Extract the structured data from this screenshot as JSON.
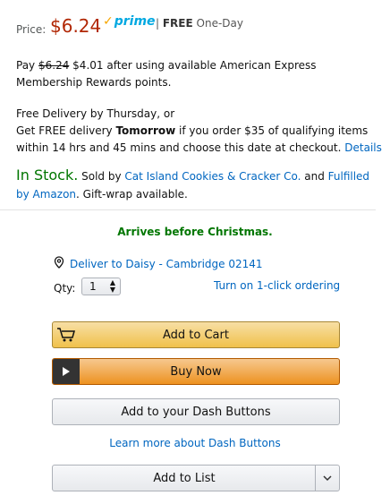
{
  "price": {
    "label": "Price:",
    "value": "$6.24",
    "prime": "prime",
    "shipping_free": "FREE",
    "shipping_speed": "One-Day"
  },
  "rewards": {
    "pay": "Pay",
    "old_price": "$6.24",
    "new_price_text": "$4.01 after using available American Express Membership Rewards points."
  },
  "delivery": {
    "line1": "Free Delivery by Thursday, or",
    "line2_a": "Get FREE delivery",
    "line2_b": "Tomorrow",
    "line2_c": "if you order $35 of qualifying items within 14 hrs and 45 mins and choose this date at checkout.",
    "details_link": "Details"
  },
  "stock": {
    "status": "In Stock.",
    "sold_by": "Sold by",
    "seller": "Cat Island Cookies & Cracker Co.",
    "and": "and",
    "fulfilled": "Fulfilled by Amazon",
    "gift": ". Gift-wrap available."
  },
  "arrives": "Arrives before Christmas.",
  "deliver_to": "Deliver to Daisy - Cambridge 02141",
  "qty": {
    "label": "Qty:",
    "value": "1"
  },
  "one_click": "Turn on 1-click ordering",
  "buttons": {
    "add_to_cart": "Add to Cart",
    "buy_now": "Buy Now",
    "dash": "Add to your Dash Buttons",
    "learn_dash": "Learn more about Dash Buttons",
    "add_to_list": "Add to List"
  }
}
